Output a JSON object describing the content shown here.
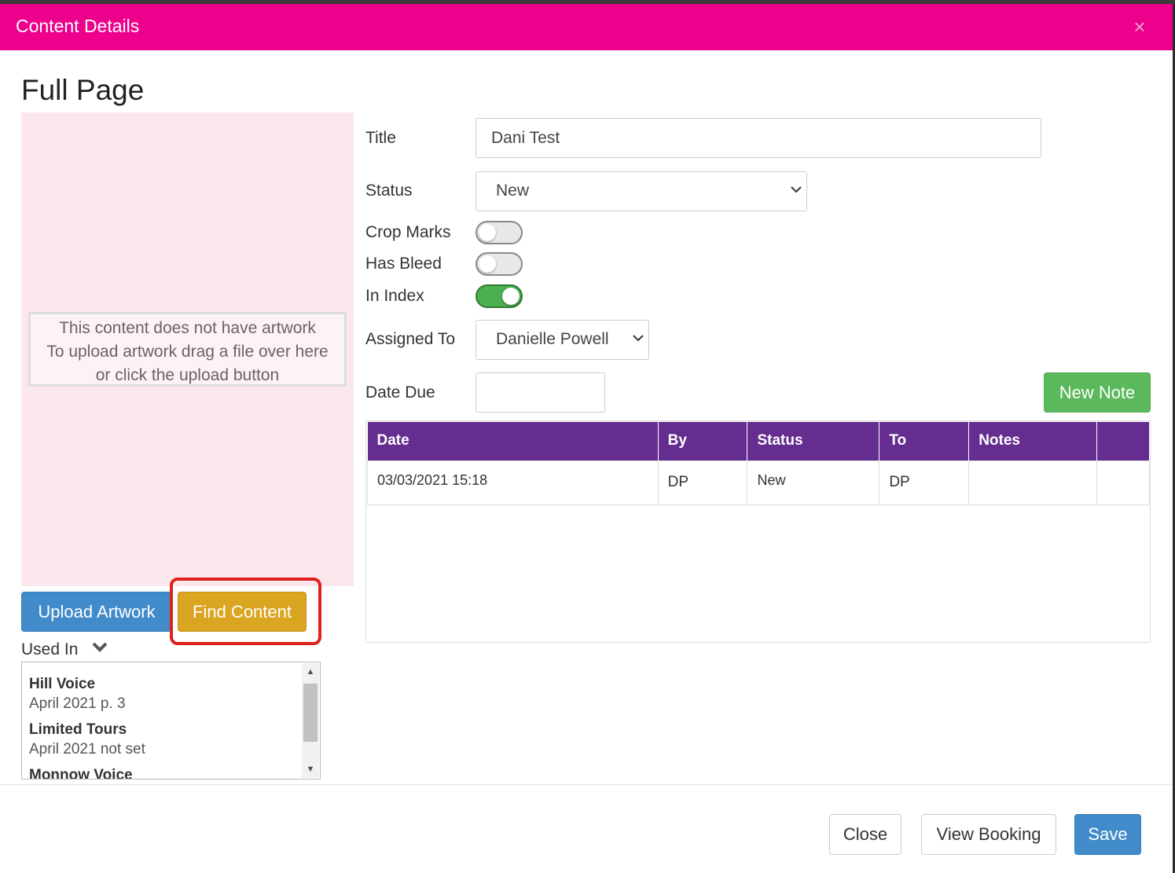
{
  "modal": {
    "header_title": "Content Details",
    "close_glyph": "×",
    "page_title": "Full Page"
  },
  "artwork": {
    "line1": "This content does not have artwork",
    "line2": "To upload artwork drag a file over here",
    "line3": "or click the upload button",
    "upload_button": "Upload Artwork",
    "find_button": "Find Content"
  },
  "used_in": {
    "label": "Used In",
    "items": [
      {
        "name": "Hill Voice",
        "detail": "April 2021 p. 3"
      },
      {
        "name": "Limited Tours",
        "detail": "April 2021 not set"
      },
      {
        "name": "Monnow Voice",
        "detail": ""
      }
    ]
  },
  "form": {
    "title_label": "Title",
    "title_value": "Dani Test",
    "status_label": "Status",
    "status_value": "New",
    "crop_marks_label": "Crop Marks",
    "crop_marks_on": false,
    "has_bleed_label": "Has Bleed",
    "has_bleed_on": false,
    "in_index_label": "In Index",
    "in_index_on": true,
    "assigned_label": "Assigned To",
    "assigned_value": "Danielle Powell",
    "date_due_label": "Date Due",
    "date_due_value": "",
    "new_note_button": "New Note"
  },
  "notes_table": {
    "headers": [
      "Date",
      "By",
      "Status",
      "To",
      "Notes",
      ""
    ],
    "rows": [
      {
        "date": "03/03/2021 15:18",
        "by": "DP",
        "status": "New",
        "to": "DP",
        "notes": ""
      }
    ]
  },
  "footer": {
    "close_button": "Close",
    "view_booking_button": "View Booking",
    "save_button": "Save"
  },
  "colors": {
    "header_bg": "#ec008c",
    "table_header_bg": "#652d90",
    "primary_blue": "#428bca",
    "gold": "#daa520",
    "green": "#5cb85c",
    "highlight_red": "#e0201d"
  }
}
